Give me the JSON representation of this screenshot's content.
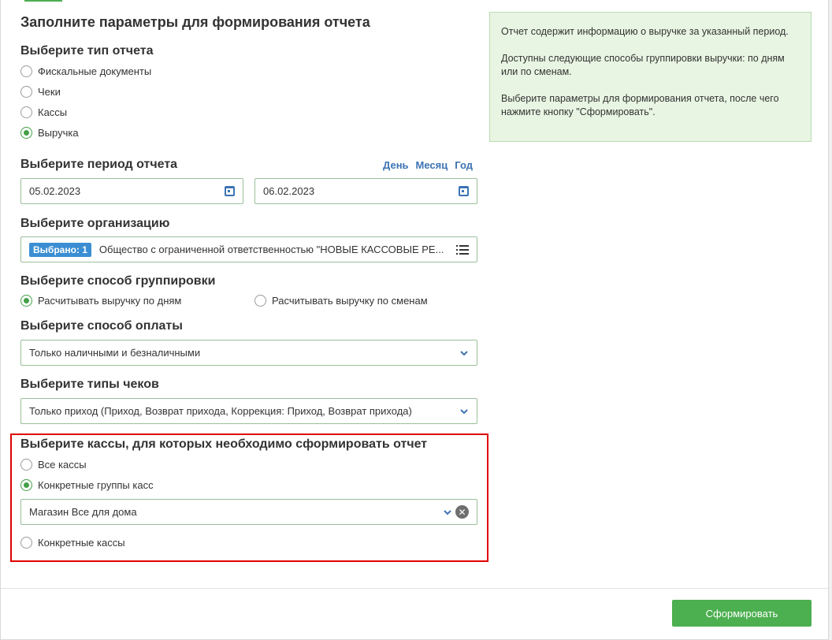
{
  "form": {
    "title": "Заполните параметры для формирования отчета",
    "report_type": {
      "title": "Выберите тип отчета",
      "options": [
        "Фискальные документы",
        "Чеки",
        "Кассы",
        "Выручка"
      ],
      "selected": "Выручка"
    },
    "period": {
      "title": "Выберите период отчета",
      "links": [
        "День",
        "Месяц",
        "Год"
      ],
      "date_from": "05.02.2023",
      "date_to": "06.02.2023"
    },
    "organization": {
      "title": "Выберите организацию",
      "badge": "Выбрано: 1",
      "value": "Общество с ограниченной ответственностью \"НОВЫЕ КАССОВЫЕ РЕ..."
    },
    "grouping": {
      "title": "Выберите способ группировки",
      "options": [
        "Расчитывать выручку по дням",
        "Расчитывать выручку по сменам"
      ],
      "selected": "Расчитывать выручку по дням"
    },
    "payment": {
      "title": "Выберите способ оплаты",
      "value": "Только наличными и безналичными"
    },
    "receipt_types": {
      "title": "Выберите типы чеков",
      "value": "Только приход (Приход, Возврат прихода, Коррекция: Приход, Возврат прихода)"
    },
    "registers": {
      "title": "Выберите кассы, для которых необходимо сформировать отчет",
      "options": [
        "Все кассы",
        "Конкретные группы касс",
        "Конкретные кассы"
      ],
      "selected": "Конкретные группы касс",
      "group_value": "Магазин Все для дома"
    }
  },
  "info": {
    "paragraphs": [
      "Отчет содержит информацию о выручке за указанный период.",
      "Доступны следующие способы группировки выручки: по дням или по сменам.",
      "Выберите параметры для формирования отчета, после чего нажмите кнопку \"Сформировать\"."
    ]
  },
  "footer": {
    "submit_label": "Сформировать"
  },
  "colors": {
    "accent_green": "#43a047",
    "button_green": "#4caf50",
    "link_blue": "#3d73b3",
    "info_bg": "#e8f5e3",
    "highlight_red": "#e00000"
  }
}
